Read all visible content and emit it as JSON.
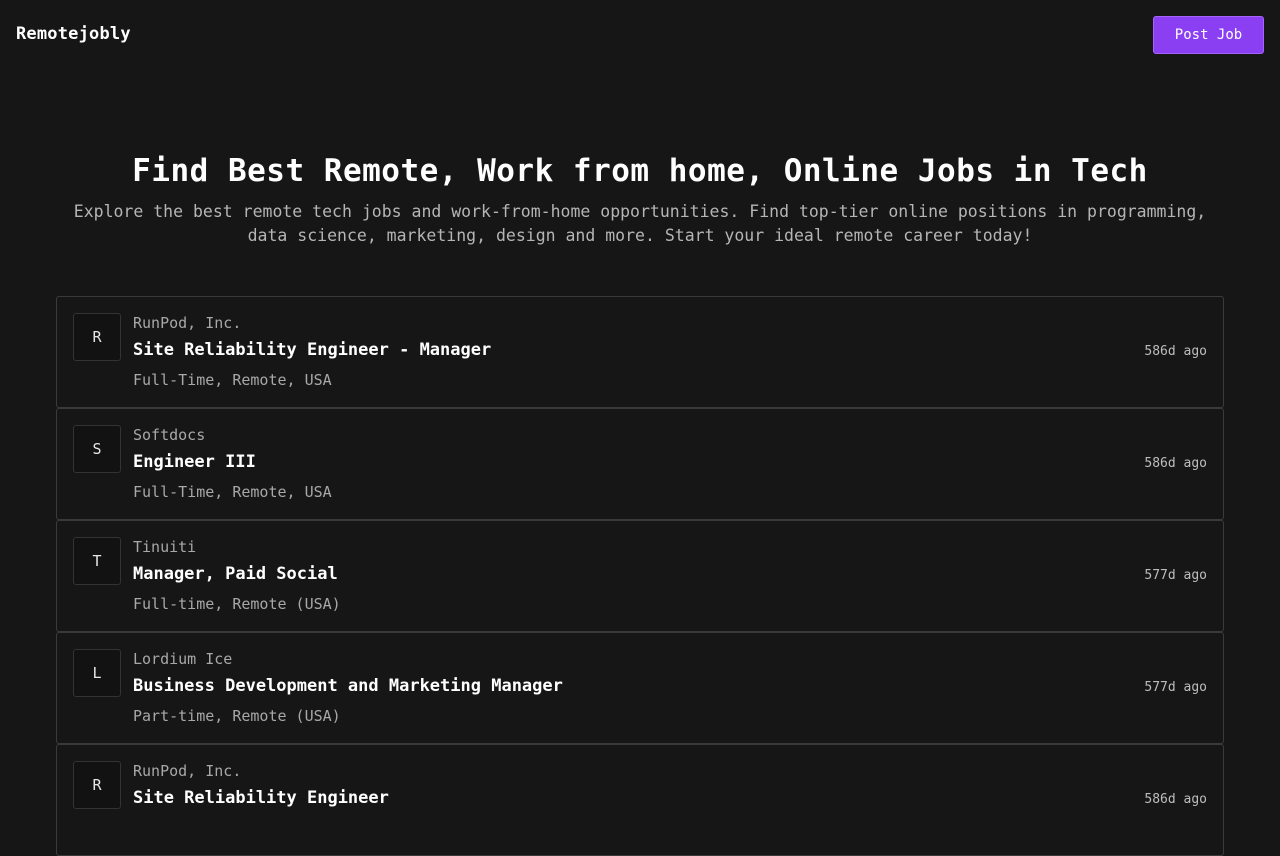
{
  "header": {
    "brand": "Remotejobly",
    "post_job_label": "Post Job"
  },
  "hero": {
    "title": "Find Best Remote, Work from home, Online Jobs in Tech",
    "subtitle": "Explore the best remote tech jobs and work-from-home opportunities. Find top-tier online positions in programming, data science, marketing, design and more. Start your ideal remote career today!"
  },
  "jobs": [
    {
      "initial": "R",
      "company": "RunPod, Inc.",
      "title": "Site Reliability Engineer - Manager",
      "meta": "Full-Time, Remote, USA",
      "age": "586d ago"
    },
    {
      "initial": "S",
      "company": "Softdocs",
      "title": "Engineer III",
      "meta": "Full-Time, Remote, USA",
      "age": "586d ago"
    },
    {
      "initial": "T",
      "company": "Tinuiti",
      "title": "Manager, Paid Social",
      "meta": "Full-time, Remote (USA)",
      "age": "577d ago"
    },
    {
      "initial": "L",
      "company": "Lordium Ice",
      "title": "Business Development and Marketing Manager",
      "meta": "Part-time, Remote (USA)",
      "age": "577d ago"
    },
    {
      "initial": "R",
      "company": "RunPod, Inc.",
      "title": "Site Reliability Engineer",
      "meta": "",
      "age": "586d ago"
    }
  ],
  "colors": {
    "background": "#161616",
    "accent": "#8b3ff2",
    "border": "#3a3a3a",
    "muted_text": "#a8a8a8"
  }
}
